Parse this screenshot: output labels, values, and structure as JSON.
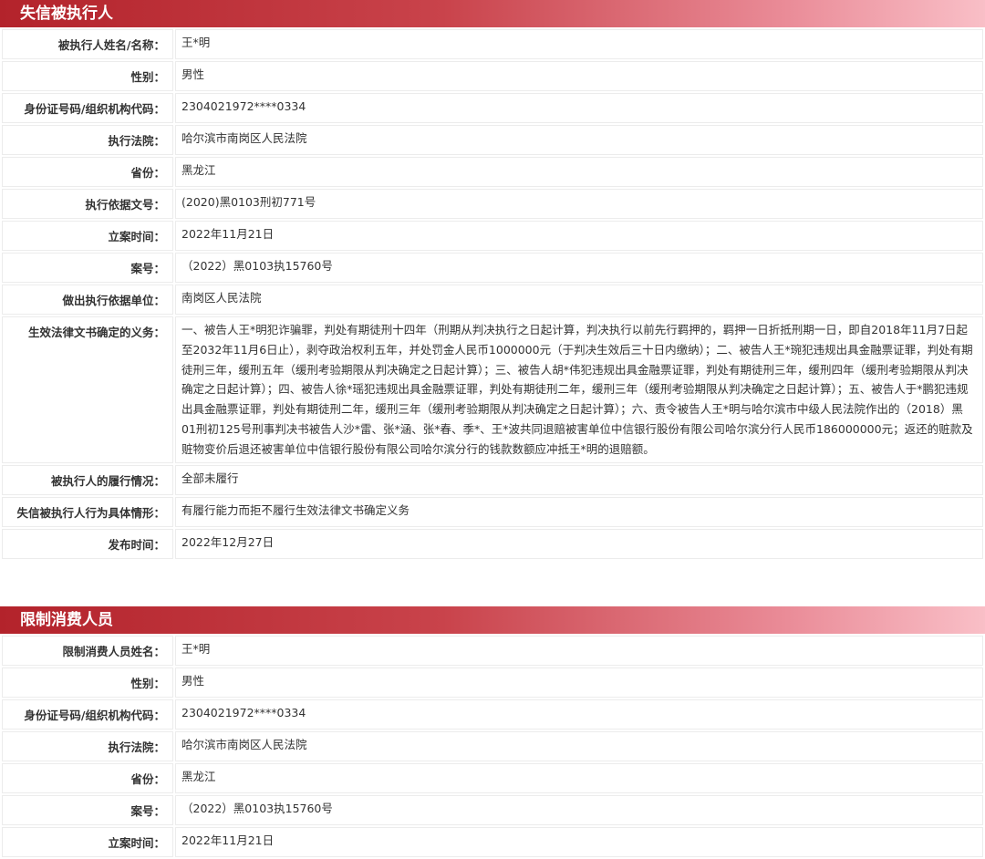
{
  "sections": [
    {
      "title": "失信被执行人",
      "rows": [
        {
          "label": "被执行人姓名/名称：",
          "value": "王*明"
        },
        {
          "label": "性别：",
          "value": "男性"
        },
        {
          "label": "身份证号码/组织机构代码：",
          "value": "2304021972****0334"
        },
        {
          "label": "执行法院：",
          "value": "哈尔滨市南岗区人民法院"
        },
        {
          "label": "省份：",
          "value": "黑龙江"
        },
        {
          "label": "执行依据文号：",
          "value": "(2020)黑0103刑初771号"
        },
        {
          "label": "立案时间：",
          "value": "2022年11月21日"
        },
        {
          "label": "案号：",
          "value": "（2022）黑0103执15760号"
        },
        {
          "label": "做出执行依据单位：",
          "value": "南岗区人民法院"
        },
        {
          "label": "生效法律文书确定的义务：",
          "value": "一、被告人王*明犯诈骗罪，判处有期徒刑十四年（刑期从判决执行之日起计算，判决执行以前先行羁押的，羁押一日折抵刑期一日，即自2018年11月7日起至2032年11月6日止），剥夺政治权利五年，并处罚金人民币1000000元（于判决生效后三十日内缴纳）；二、被告人王*琬犯违规出具金融票证罪，判处有期徒刑三年，缓刑五年（缓刑考验期限从判决确定之日起计算）；三、被告人胡*伟犯违规出具金融票证罪，判处有期徒刑三年，缓刑四年（缓刑考验期限从判决确定之日起计算）；四、被告人徐*瑶犯违规出具金融票证罪，判处有期徒刑二年，缓刑三年（缓刑考验期限从判决确定之日起计算）；五、被告人于*鹏犯违规出具金融票证罪，判处有期徒刑二年，缓刑三年（缓刑考验期限从判决确定之日起计算）；六、责令被告人王*明与哈尔滨市中级人民法院作出的（2018）黑01刑初125号刑事判决书被告人沙*雷、张*涵、张*春、季*、王*波共同退赔被害单位中信银行股份有限公司哈尔滨分行人民币186000000元；返还的赃款及赃物变价后退还被害单位中信银行股份有限公司哈尔滨分行的钱款数额应冲抵王*明的退赔额。"
        },
        {
          "label": "被执行人的履行情况：",
          "value": "全部未履行"
        },
        {
          "label": "失信被执行人行为具体情形：",
          "value": "有履行能力而拒不履行生效法律文书确定义务"
        },
        {
          "label": "发布时间：",
          "value": "2022年12月27日"
        }
      ]
    },
    {
      "title": "限制消费人员",
      "rows": [
        {
          "label": "限制消费人员姓名：",
          "value": "王*明"
        },
        {
          "label": "性别：",
          "value": "男性"
        },
        {
          "label": "身份证号码/组织机构代码：",
          "value": "2304021972****0334"
        },
        {
          "label": "执行法院：",
          "value": "哈尔滨市南岗区人民法院"
        },
        {
          "label": "省份：",
          "value": "黑龙江"
        },
        {
          "label": "案号：",
          "value": "（2022）黑0103执15760号"
        },
        {
          "label": "立案时间：",
          "value": "2022年11月21日"
        }
      ]
    }
  ]
}
